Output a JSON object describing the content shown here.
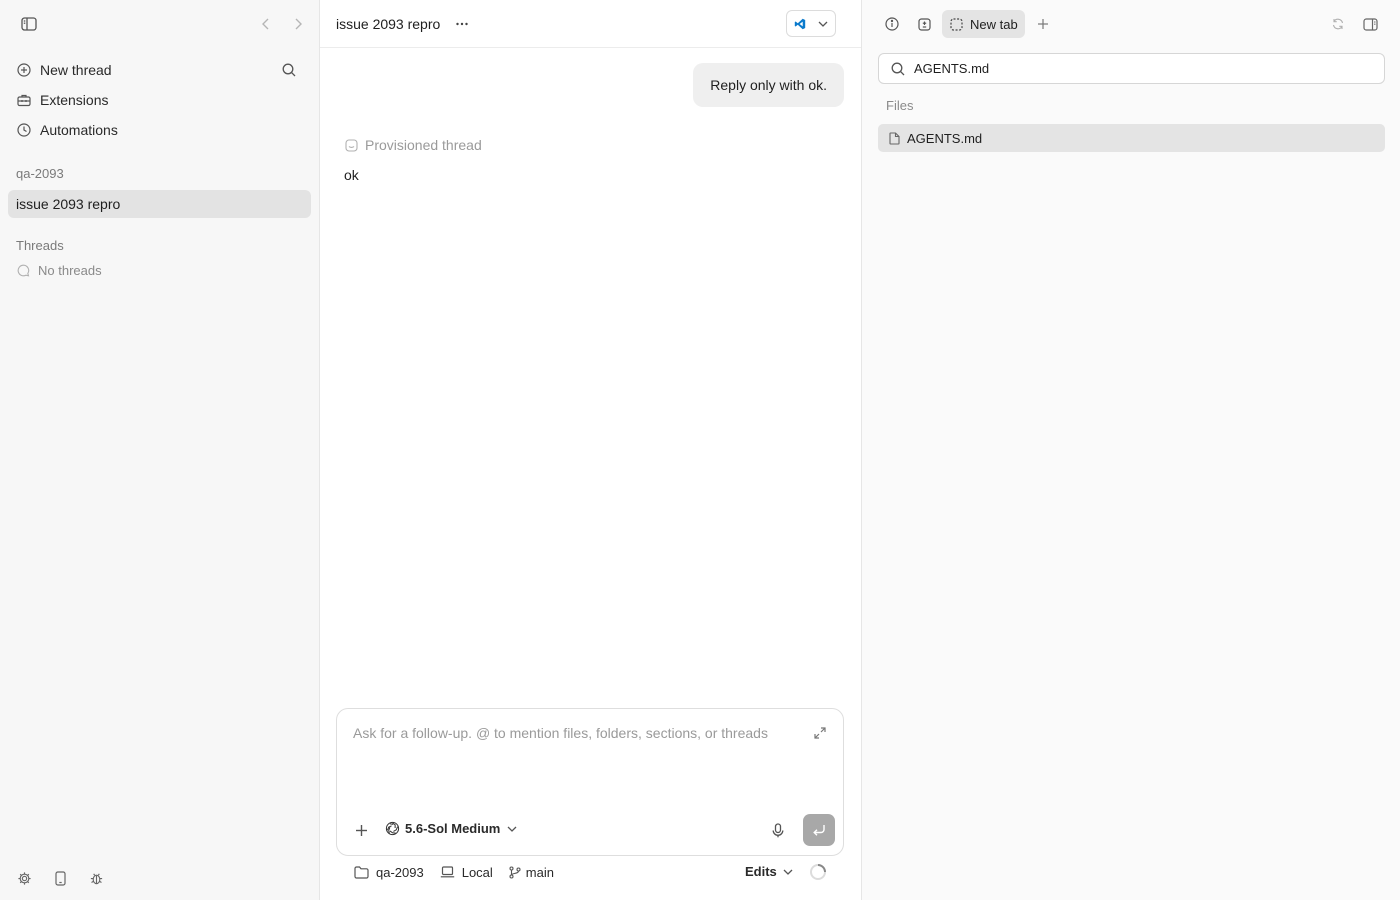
{
  "sidebar": {
    "nav": [
      {
        "label": "New thread",
        "icon": "plus-circle-icon"
      },
      {
        "label": "Extensions",
        "icon": "toolbox-icon"
      },
      {
        "label": "Automations",
        "icon": "clock-icon"
      }
    ],
    "project_name": "qa-2093",
    "project_thread": "issue 2093 repro",
    "threads_heading": "Threads",
    "threads_empty": "No threads"
  },
  "main": {
    "title": "issue 2093 repro",
    "user_message": "Reply only with ok.",
    "status": "Provisioned thread",
    "assistant_reply": "ok",
    "composer": {
      "placeholder": "Ask for a follow-up. @ to mention files, folders, sections, or threads",
      "model": "5.6-Sol Medium"
    },
    "footer": {
      "project": "qa-2093",
      "environment": "Local",
      "branch": "main",
      "mode": "Edits"
    }
  },
  "right_panel": {
    "active_tab": "New tab",
    "search_value": "AGENTS.md",
    "section_label": "Files",
    "results": [
      "AGENTS.md"
    ]
  },
  "colors": {
    "sidebar_bg": "#f7f7f7",
    "selection_bg": "#e3e3e3",
    "bubble_bg": "#efefef",
    "send_button": "#a8a8a8",
    "vscode_blue": "#0a7acc"
  }
}
